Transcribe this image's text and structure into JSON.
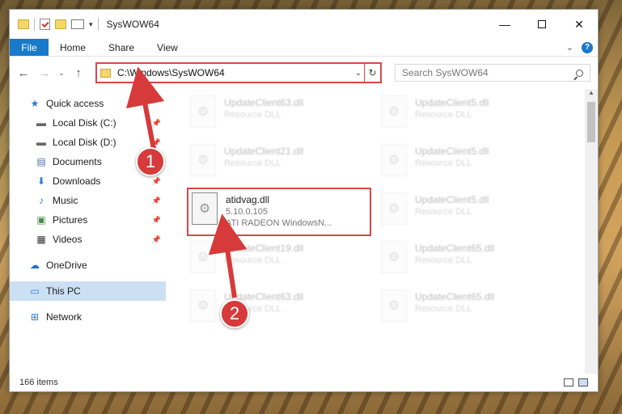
{
  "window": {
    "title": "SysWOW64",
    "minimize": "—",
    "maximize": "",
    "close": "✕"
  },
  "ribbon": {
    "file": "File",
    "tabs": [
      "Home",
      "Share",
      "View"
    ],
    "expand": "⌄",
    "help": "?"
  },
  "nav": {
    "back": "←",
    "forward": "→",
    "recent": "⌄",
    "up": "↑",
    "address": "C:\\Windows\\SysWOW64",
    "address_drop": "⌄",
    "refresh": "↻",
    "search_placeholder": "Search SysWOW64"
  },
  "sidebar": {
    "quick_access": "Quick access",
    "items": [
      {
        "label": "Local Disk (C:)",
        "icon": "drive-icon"
      },
      {
        "label": "Local Disk (D:)",
        "icon": "drive-icon"
      },
      {
        "label": "Documents",
        "icon": "documents-icon"
      },
      {
        "label": "Downloads",
        "icon": "downloads-icon"
      },
      {
        "label": "Music",
        "icon": "music-icon"
      },
      {
        "label": "Pictures",
        "icon": "pictures-icon"
      },
      {
        "label": "Videos",
        "icon": "videos-icon"
      }
    ],
    "onedrive": "OneDrive",
    "this_pc": "This PC",
    "network": "Network"
  },
  "files": [
    {
      "name": "UpdateClient63.dll",
      "sub": "Resource DLL"
    },
    {
      "name": "UpdateClient5.dll",
      "sub": "Resource DLL"
    },
    {
      "name": "UpdateClient21.dll",
      "sub": "Resource DLL"
    },
    {
      "name": "UpdateClient5.dll",
      "sub": "Resource DLL"
    },
    {
      "name": "atidvag.dll",
      "version": "5.10.0.105",
      "desc": "ATI RADEON WindowsN..."
    },
    {
      "name": "UpdateClient5.dll",
      "sub": "Resource DLL"
    },
    {
      "name": "UpdateClient19.dll",
      "sub": "Resource DLL"
    },
    {
      "name": "UpdateClient65.dll",
      "sub": "Resource DLL"
    },
    {
      "name": "UpdateClient63.dll",
      "sub": "Resource DLL"
    },
    {
      "name": "UpdateClient65.dll",
      "sub": "Resource DLL"
    }
  ],
  "status": {
    "count": "166 items"
  },
  "annotations": {
    "step1": "1",
    "step2": "2",
    "color": "#d63a3a"
  }
}
